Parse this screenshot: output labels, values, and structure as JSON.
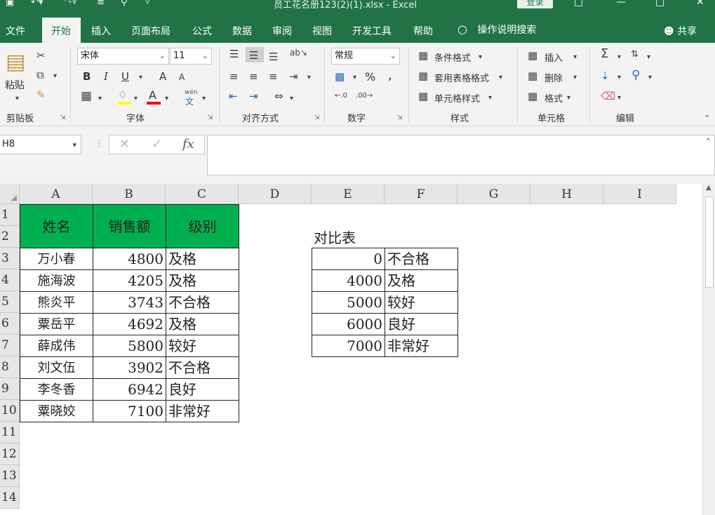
{
  "title_bar": {
    "title": "员工花名册123(2)(1).xlsx  -  Excel",
    "login_label": "登录",
    "quick_access": [
      "save-icon",
      "undo-icon",
      "redo-icon",
      "customize-icon",
      "print-preview-icon"
    ]
  },
  "menu": {
    "tabs": [
      "文件",
      "开始",
      "插入",
      "页面布局",
      "公式",
      "数据",
      "审阅",
      "视图",
      "开发工具",
      "帮助"
    ],
    "active": "开始",
    "tell_me": "操作说明搜索",
    "share": "共享"
  },
  "ribbon": {
    "clipboard": {
      "paste": "粘贴",
      "group_label": "剪贴板"
    },
    "font": {
      "font_name": "宋体",
      "font_size": "11",
      "bold": "B",
      "italic": "I",
      "underline": "U",
      "grow": "A",
      "shrink": "A",
      "font_color_glyph": "A",
      "phonetic": "wén",
      "group_label": "字体"
    },
    "alignment": {
      "group_label": "对齐方式"
    },
    "number": {
      "format": "常规",
      "percent": "%",
      "comma": ",",
      "group_label": "数字"
    },
    "styles": {
      "conditional": "条件格式",
      "table": "套用表格格式",
      "cell_styles": "单元格样式",
      "group_label": "样式"
    },
    "cells": {
      "insert": "插入",
      "delete": "删除",
      "format": "格式",
      "group_label": "单元格"
    },
    "editing": {
      "group_label": "编辑"
    },
    "accent_color": "#217346"
  },
  "formula_bar": {
    "name_box": "H8",
    "fx": "fx",
    "cancel": "✕",
    "enter": "✓",
    "formula": ""
  },
  "sheet": {
    "columns": [
      "A",
      "B",
      "C",
      "D",
      "E",
      "F",
      "G",
      "H",
      "I"
    ],
    "rows": [
      "1",
      "2",
      "3",
      "4",
      "5",
      "6",
      "7",
      "8",
      "9",
      "10",
      "11",
      "12",
      "13",
      "14"
    ],
    "header_fill": "#00b050",
    "main_table": {
      "headers": [
        "姓名",
        "销售额",
        "级别"
      ],
      "rows": [
        [
          "万小春",
          "4800",
          "及格"
        ],
        [
          "施海波",
          "4205",
          "及格"
        ],
        [
          "熊炎平",
          "3743",
          "不合格"
        ],
        [
          "粟岳平",
          "4692",
          "及格"
        ],
        [
          "薛成伟",
          "5800",
          "较好"
        ],
        [
          "刘文伍",
          "3902",
          "不合格"
        ],
        [
          "李冬香",
          "6942",
          "良好"
        ],
        [
          "粟晓姣",
          "7100",
          "非常好"
        ]
      ]
    },
    "lookup_table": {
      "title": "对比表",
      "rows": [
        [
          "0",
          "不合格"
        ],
        [
          "4000",
          "及格"
        ],
        [
          "5000",
          "较好"
        ],
        [
          "6000",
          "良好"
        ],
        [
          "7000",
          "非常好"
        ]
      ]
    }
  }
}
